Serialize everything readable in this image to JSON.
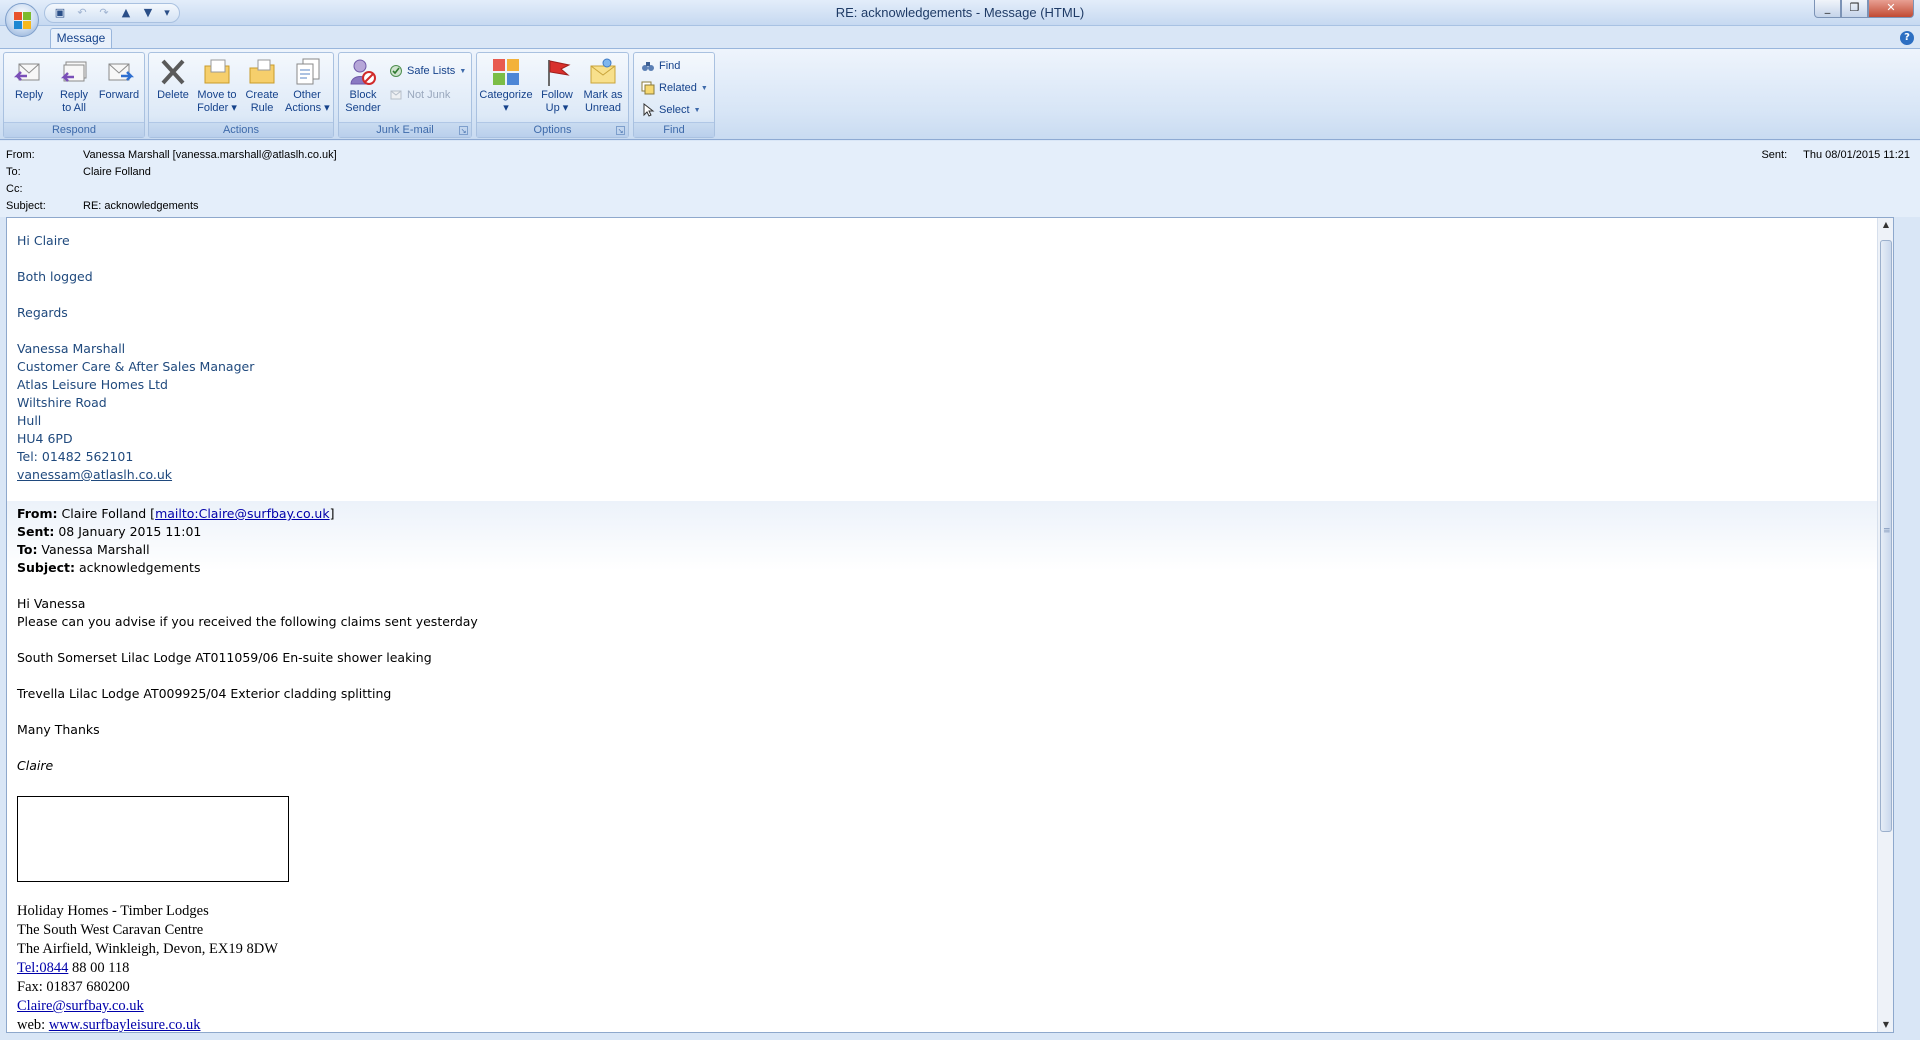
{
  "window": {
    "title": "RE: acknowledgements - Message (HTML)",
    "help_glyph": "?",
    "minimize_glyph": "_",
    "restore_glyph": "❐",
    "close_glyph": "✕"
  },
  "qat": {
    "save_glyph": "▣",
    "undo_glyph": "↶",
    "redo_glyph": "↷",
    "prev_glyph": "▲",
    "next_glyph": "▼",
    "customize_glyph": "▾"
  },
  "ribbon": {
    "tab": "Message",
    "groups": {
      "respond": "Respond",
      "actions": "Actions",
      "junk": "Junk E-mail",
      "options": "Options",
      "find": "Find"
    },
    "buttons": {
      "reply": [
        "Reply",
        ""
      ],
      "reply_all": [
        "Reply",
        "to All"
      ],
      "forward": [
        "Forward",
        ""
      ],
      "delete": [
        "Delete",
        ""
      ],
      "move": [
        "Move to",
        "Folder ▾"
      ],
      "create_rule": [
        "Create",
        "Rule"
      ],
      "other_actions": [
        "Other",
        "Actions ▾"
      ],
      "block_sender": [
        "Block",
        "Sender"
      ],
      "safe_lists": "Safe Lists",
      "not_junk": "Not Junk",
      "categorize": [
        "Categorize",
        "▾"
      ],
      "follow_up": [
        "Follow",
        "Up ▾"
      ],
      "mark_unread": [
        "Mark as",
        "Unread"
      ],
      "find": "Find",
      "related": "Related",
      "select": "Select"
    },
    "colors": {
      "label": "#15428b",
      "group_label": "#3e6aaa",
      "flag": "#d9302c"
    }
  },
  "header": {
    "from_label": "From:",
    "from_value": "Vanessa Marshall [vanessa.marshall@atlaslh.co.uk]",
    "to_label": "To:",
    "to_value": "Claire Folland",
    "cc_label": "Cc:",
    "cc_value": "",
    "subject_label": "Subject:",
    "subject_value": "RE: acknowledgements",
    "sent_label": "Sent:",
    "sent_value": "Thu 08/01/2015 11:21"
  },
  "reply": {
    "greeting": "Hi Claire",
    "line1": "Both logged",
    "closing": "Regards",
    "sig_name": "Vanessa Marshall",
    "sig_title": "Customer Care & After Sales Manager",
    "sig_company": "Atlas Leisure Homes Ltd",
    "sig_street": "Wiltshire Road",
    "sig_city": "Hull",
    "sig_postcode": "HU4 6PD",
    "sig_tel": "Tel: 01482 562101",
    "sig_email": "vanessam@atlaslh.co.uk",
    "color": "#1f497d"
  },
  "original": {
    "from_label": "From:",
    "from_name": " Claire Folland [",
    "from_mailto": "mailto:Claire@surfbay.co.uk",
    "from_close": "]",
    "sent_label": "Sent:",
    "sent_value": " 08 January 2015 11:01",
    "to_label": "To:",
    "to_value": " Vanessa Marshall",
    "subject_label": "Subject:",
    "subject_value": " acknowledgements",
    "greeting": "Hi Vanessa",
    "request": "Please can you advise if you received the following claims sent yesterday",
    "claim1": "South Somerset Lilac Lodge AT011059/06 En-suite shower leaking",
    "claim2": "Trevella Lilac Lodge AT009925/04 Exterior cladding splitting",
    "thanks": "Many Thanks",
    "name": "Claire"
  },
  "signature": {
    "line1": "Holiday Homes - Timber Lodges",
    "line2": "The South West Caravan Centre",
    "line3": "The Airfield, Winkleigh, Devon, EX19 8DW",
    "tel_link": "Tel:0844",
    "tel_rest": " 88 00 118",
    "fax": "Fax: 01837 680200",
    "email": "Claire@surfbay.co.uk",
    "web_label": "web: ",
    "web_link": "www.surfbayleisure.co.uk"
  },
  "scroll": {
    "up_glyph": "▲",
    "down_glyph": "▼"
  }
}
